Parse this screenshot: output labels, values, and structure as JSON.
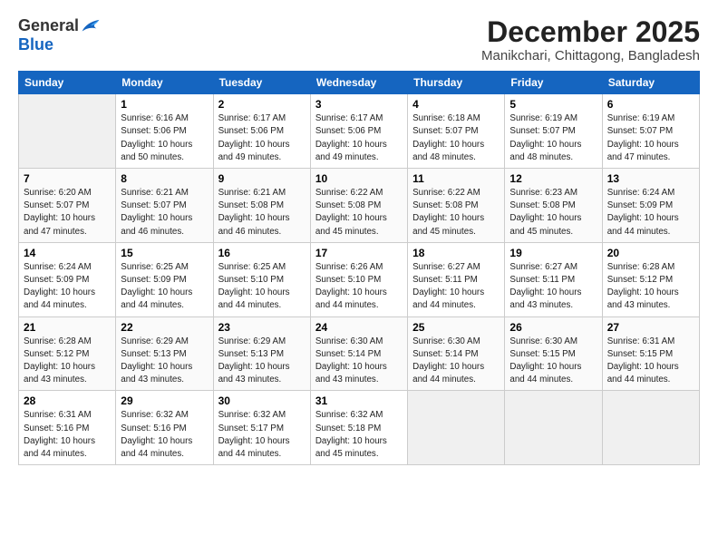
{
  "logo": {
    "general": "General",
    "blue": "Blue"
  },
  "title": "December 2025",
  "subtitle": "Manikchari, Chittagong, Bangladesh",
  "days_of_week": [
    "Sunday",
    "Monday",
    "Tuesday",
    "Wednesday",
    "Thursday",
    "Friday",
    "Saturday"
  ],
  "weeks": [
    [
      {
        "day": "",
        "empty": true
      },
      {
        "day": "1",
        "sunrise": "6:16 AM",
        "sunset": "5:06 PM",
        "daylight": "10 hours and 50 minutes."
      },
      {
        "day": "2",
        "sunrise": "6:17 AM",
        "sunset": "5:06 PM",
        "daylight": "10 hours and 49 minutes."
      },
      {
        "day": "3",
        "sunrise": "6:17 AM",
        "sunset": "5:06 PM",
        "daylight": "10 hours and 49 minutes."
      },
      {
        "day": "4",
        "sunrise": "6:18 AM",
        "sunset": "5:07 PM",
        "daylight": "10 hours and 48 minutes."
      },
      {
        "day": "5",
        "sunrise": "6:19 AM",
        "sunset": "5:07 PM",
        "daylight": "10 hours and 48 minutes."
      },
      {
        "day": "6",
        "sunrise": "6:19 AM",
        "sunset": "5:07 PM",
        "daylight": "10 hours and 47 minutes."
      }
    ],
    [
      {
        "day": "7",
        "sunrise": "6:20 AM",
        "sunset": "5:07 PM",
        "daylight": "10 hours and 47 minutes."
      },
      {
        "day": "8",
        "sunrise": "6:21 AM",
        "sunset": "5:07 PM",
        "daylight": "10 hours and 46 minutes."
      },
      {
        "day": "9",
        "sunrise": "6:21 AM",
        "sunset": "5:08 PM",
        "daylight": "10 hours and 46 minutes."
      },
      {
        "day": "10",
        "sunrise": "6:22 AM",
        "sunset": "5:08 PM",
        "daylight": "10 hours and 45 minutes."
      },
      {
        "day": "11",
        "sunrise": "6:22 AM",
        "sunset": "5:08 PM",
        "daylight": "10 hours and 45 minutes."
      },
      {
        "day": "12",
        "sunrise": "6:23 AM",
        "sunset": "5:08 PM",
        "daylight": "10 hours and 45 minutes."
      },
      {
        "day": "13",
        "sunrise": "6:24 AM",
        "sunset": "5:09 PM",
        "daylight": "10 hours and 44 minutes."
      }
    ],
    [
      {
        "day": "14",
        "sunrise": "6:24 AM",
        "sunset": "5:09 PM",
        "daylight": "10 hours and 44 minutes."
      },
      {
        "day": "15",
        "sunrise": "6:25 AM",
        "sunset": "5:09 PM",
        "daylight": "10 hours and 44 minutes."
      },
      {
        "day": "16",
        "sunrise": "6:25 AM",
        "sunset": "5:10 PM",
        "daylight": "10 hours and 44 minutes."
      },
      {
        "day": "17",
        "sunrise": "6:26 AM",
        "sunset": "5:10 PM",
        "daylight": "10 hours and 44 minutes."
      },
      {
        "day": "18",
        "sunrise": "6:27 AM",
        "sunset": "5:11 PM",
        "daylight": "10 hours and 44 minutes."
      },
      {
        "day": "19",
        "sunrise": "6:27 AM",
        "sunset": "5:11 PM",
        "daylight": "10 hours and 43 minutes."
      },
      {
        "day": "20",
        "sunrise": "6:28 AM",
        "sunset": "5:12 PM",
        "daylight": "10 hours and 43 minutes."
      }
    ],
    [
      {
        "day": "21",
        "sunrise": "6:28 AM",
        "sunset": "5:12 PM",
        "daylight": "10 hours and 43 minutes."
      },
      {
        "day": "22",
        "sunrise": "6:29 AM",
        "sunset": "5:13 PM",
        "daylight": "10 hours and 43 minutes."
      },
      {
        "day": "23",
        "sunrise": "6:29 AM",
        "sunset": "5:13 PM",
        "daylight": "10 hours and 43 minutes."
      },
      {
        "day": "24",
        "sunrise": "6:30 AM",
        "sunset": "5:14 PM",
        "daylight": "10 hours and 43 minutes."
      },
      {
        "day": "25",
        "sunrise": "6:30 AM",
        "sunset": "5:14 PM",
        "daylight": "10 hours and 44 minutes."
      },
      {
        "day": "26",
        "sunrise": "6:30 AM",
        "sunset": "5:15 PM",
        "daylight": "10 hours and 44 minutes."
      },
      {
        "day": "27",
        "sunrise": "6:31 AM",
        "sunset": "5:15 PM",
        "daylight": "10 hours and 44 minutes."
      }
    ],
    [
      {
        "day": "28",
        "sunrise": "6:31 AM",
        "sunset": "5:16 PM",
        "daylight": "10 hours and 44 minutes."
      },
      {
        "day": "29",
        "sunrise": "6:32 AM",
        "sunset": "5:16 PM",
        "daylight": "10 hours and 44 minutes."
      },
      {
        "day": "30",
        "sunrise": "6:32 AM",
        "sunset": "5:17 PM",
        "daylight": "10 hours and 44 minutes."
      },
      {
        "day": "31",
        "sunrise": "6:32 AM",
        "sunset": "5:18 PM",
        "daylight": "10 hours and 45 minutes."
      },
      {
        "day": "",
        "empty": true
      },
      {
        "day": "",
        "empty": true
      },
      {
        "day": "",
        "empty": true
      }
    ]
  ]
}
